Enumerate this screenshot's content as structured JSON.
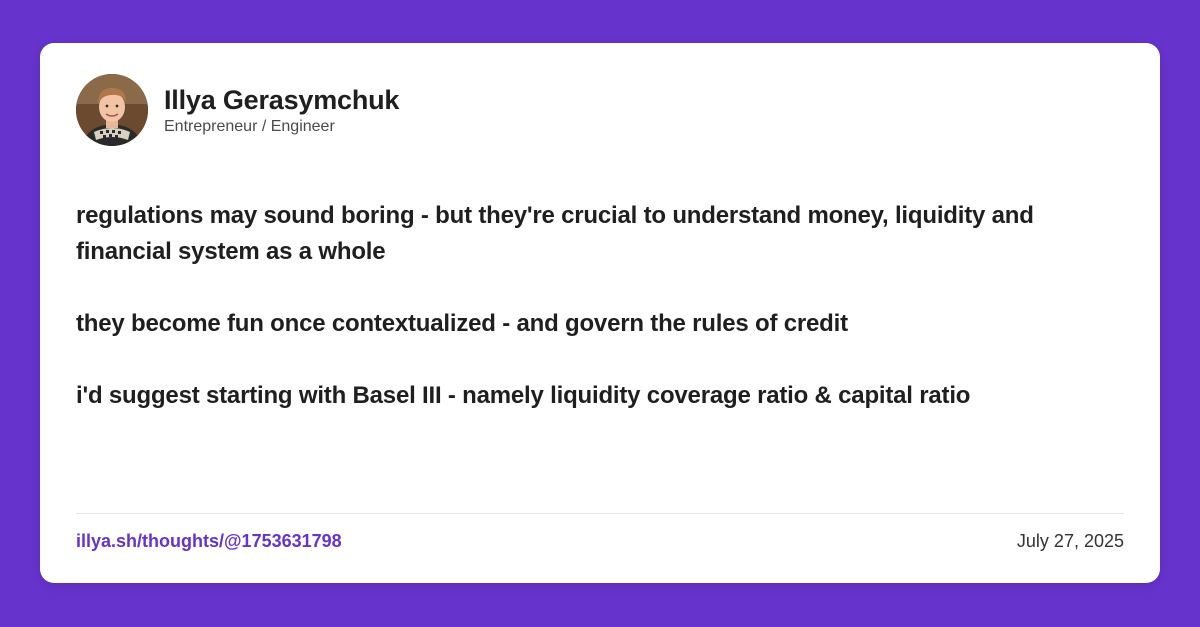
{
  "colors": {
    "background": "#6633cc",
    "card": "#ffffff",
    "text": "#1f1f1f",
    "link": "#6633cc"
  },
  "author": {
    "name": "Illya Gerasymchuk",
    "role": "Entrepreneur / Engineer"
  },
  "post": {
    "paragraphs": [
      "regulations may sound boring - but they're crucial to understand money, liquidity and financial system as a whole",
      "they become fun once contextualized - and govern the rules of credit",
      "i'd suggest starting with Basel III - namely liquidity coverage ratio & capital ratio"
    ]
  },
  "footer": {
    "link_text": "illya.sh/thoughts/@1753631798",
    "date": "July 27, 2025"
  }
}
